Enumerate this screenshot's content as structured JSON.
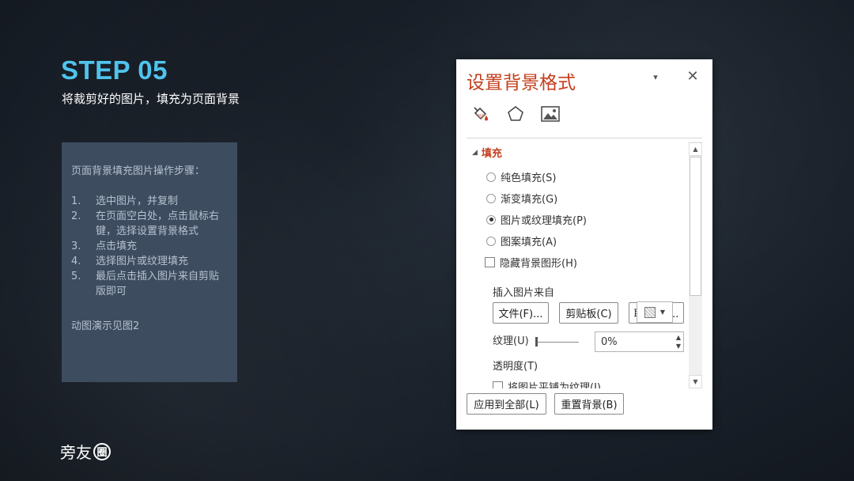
{
  "slide": {
    "step_title": "STEP 05",
    "subtitle": "将裁剪好的图片，填充为页面背景",
    "instruction_heading": "页面背景填充图片操作步骤：",
    "steps": [
      {
        "num": "1.",
        "text": "选中图片，并复制"
      },
      {
        "num": "2.",
        "text": "在页面空白处，点击鼠标右键，选择设置背景格式"
      },
      {
        "num": "3.",
        "text": "点击填充"
      },
      {
        "num": "4.",
        "text": "选择图片或纹理填充"
      },
      {
        "num": "5.",
        "text": "最后点击插入图片来自剪贴版即可"
      }
    ],
    "note": "动图演示见图2",
    "logo": {
      "chars": "旁友",
      "circle_char": "圈"
    }
  },
  "dialog": {
    "title": "设置背景格式",
    "dropdown_icon": "▾",
    "close_icon": "✕",
    "tabs": [
      "fill-bucket-icon",
      "pentagon-icon",
      "picture-icon"
    ],
    "section": {
      "arrow": "◢",
      "label": "填充"
    },
    "fill_options": [
      {
        "label": "纯色填充(S)",
        "checked": false
      },
      {
        "label": "渐变填充(G)",
        "checked": false
      },
      {
        "label": "图片或纹理填充(P)",
        "checked": true
      },
      {
        "label": "图案填充(A)",
        "checked": false
      }
    ],
    "hide_bg_graphics": "隐藏背景图形(H)",
    "insert_from_label": "插入图片来自",
    "insert_buttons": [
      "文件(F)...",
      "剪贴板(C)",
      "联机(E)..."
    ],
    "texture_label": "纹理(U)",
    "transparency_label": "透明度(T)",
    "transparency_value": "0%",
    "tile_label": "将图片平铺为纹理(I)",
    "footer_buttons": [
      "应用到全部(L)",
      "重置背景(B)"
    ],
    "accent_color": "#c43e1c"
  }
}
